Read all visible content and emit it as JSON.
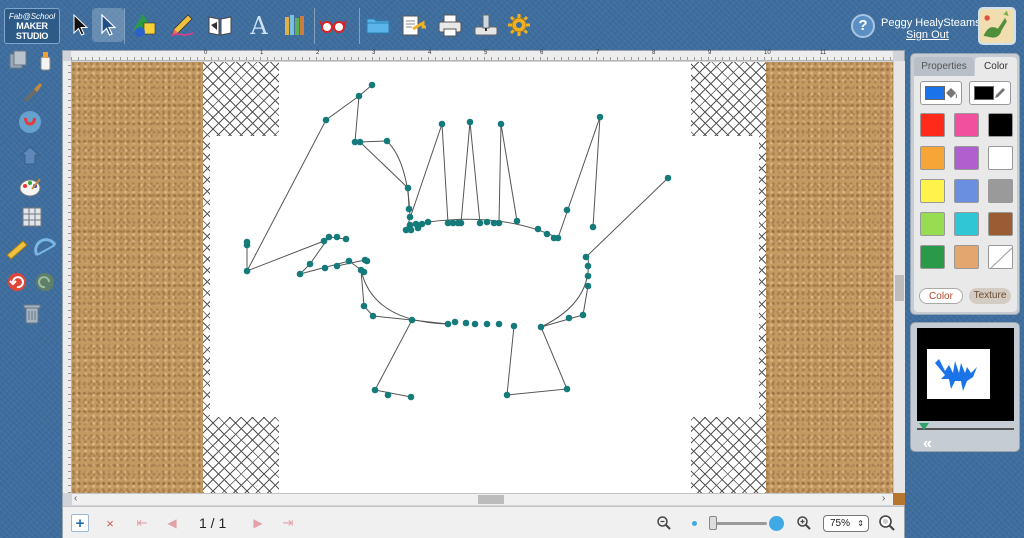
{
  "app": {
    "logo_line1": "Fab@School",
    "logo_line2": "MAKER STUDIO"
  },
  "user": {
    "name": "Peggy HealySteams",
    "sign_out": "Sign Out",
    "help": "?"
  },
  "toolbar": {
    "tools": [
      {
        "name": "select-arrow-icon"
      },
      {
        "name": "point-select-arrow-icon",
        "selected": true
      },
      {
        "name": "shapes-icon"
      },
      {
        "name": "pencil-icon"
      },
      {
        "name": "book-icon"
      },
      {
        "name": "text-icon",
        "glyph": "A"
      },
      {
        "name": "library-icon"
      },
      {
        "name": "glasses-icon"
      },
      {
        "name": "folder-icon"
      },
      {
        "name": "export-icon"
      },
      {
        "name": "print-icon"
      },
      {
        "name": "cutter-icon"
      },
      {
        "name": "settings-gear-icon"
      }
    ]
  },
  "left_tools": [
    "duplicate-icon",
    "glue-icon",
    "brush-icon",
    "magnet-icon",
    "undo-shape-icon",
    "paint-palette-icon",
    "grid-icon",
    "ruler-icon",
    "protractor-icon",
    "undo-icon",
    "redo-icon",
    "trash-icon"
  ],
  "ruler_numbers": [
    "0",
    "1",
    "2",
    "3",
    "4",
    "5",
    "6",
    "7",
    "8",
    "9",
    "10",
    "11"
  ],
  "bottom": {
    "add_page": "+",
    "delete_page": "×",
    "first": "⇤",
    "prev": "◀",
    "page_indicator": "1 / 1",
    "next": "▶",
    "last": "⇥",
    "zoom_value": "75%",
    "zoom_caret": "⇕"
  },
  "properties_panel": {
    "tab_properties": "Properties",
    "tab_color": "Color",
    "current_fill": "#1a73e8",
    "current_stroke": "#000000",
    "swatches": [
      "#ff2a1a",
      "#f0509e",
      "#000000",
      "#f5a636",
      "#b05fcf",
      "#ffffff",
      "#fff24a",
      "#6b8fe0",
      "#9a9a9a",
      "#98dc52",
      "#2fc6d6",
      "#9b5c33",
      "#2a9a49",
      "#e4a66f",
      "none"
    ],
    "btn_color": "Color",
    "btn_texture": "Texture"
  },
  "preview": {
    "collapse": "«"
  }
}
